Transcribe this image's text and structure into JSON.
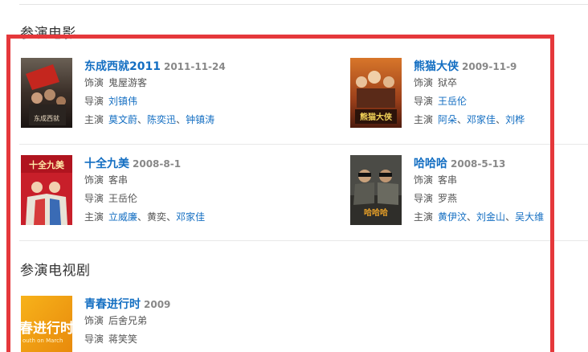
{
  "sections": {
    "movies_heading": "参演电影",
    "tv_heading": "参演电视剧"
  },
  "labels": {
    "role": "饰演",
    "director": "导演",
    "cast": "主演",
    "cast_sep": "、"
  },
  "movies": [
    {
      "title": "东成西就2011",
      "date": "2011-11-24",
      "role": "鬼屋游客",
      "director": "刘镇伟",
      "cast": [
        "莫文蔚",
        "陈奕迅",
        "钟镇涛"
      ]
    },
    {
      "title": "熊猫大侠",
      "date": "2009-11-9",
      "role": "狱卒",
      "director": "王岳伦",
      "cast": [
        "阿朵",
        "邓家佳",
        "刘桦"
      ]
    },
    {
      "title": "十全九美",
      "date": "2008-8-1",
      "role": "客串",
      "director": "王岳伦",
      "cast": [
        "立威廉",
        "黄奕",
        "邓家佳"
      ]
    },
    {
      "title": "哈哈哈",
      "date": "2008-5-13",
      "role": "客串",
      "director": "罗燕",
      "cast": [
        "黄伊汶",
        "刘金山",
        "吴大维"
      ]
    }
  ],
  "tv": [
    {
      "title": "青春进行时",
      "date": "2009",
      "role": "后舍兄弟",
      "director": "蒋笑笑",
      "poster_text": "春进行时",
      "poster_subtext": "outh on March"
    }
  ],
  "posters": {
    "p1_text": "东成西就",
    "p2_text": "熊猫大侠",
    "p3_text": "十全九美",
    "p4_text": "哈哈哈"
  },
  "colors": {
    "link": "#136ec2",
    "highlight": "#e5383b"
  }
}
